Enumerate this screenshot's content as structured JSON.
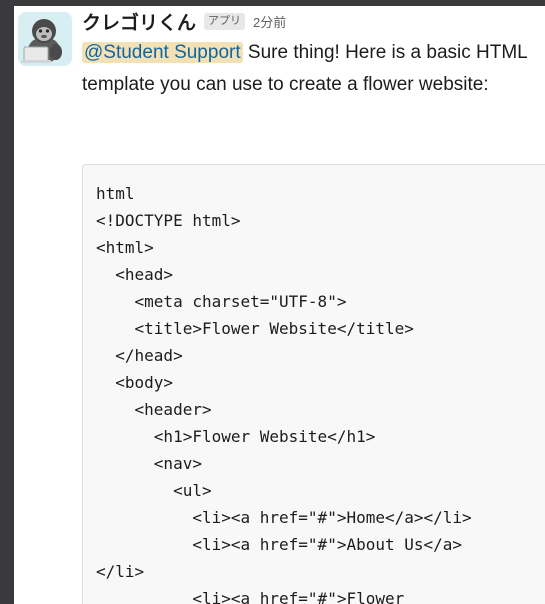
{
  "message": {
    "bot_name": "クレゴリくん",
    "app_badge": "アプリ",
    "timestamp": "2分前",
    "mention": "@Student Support",
    "text_after_mention": " Sure thing! Here is a basic HTML template you can use to create a flower website:",
    "code_lines": [
      "html",
      "<!DOCTYPE html>",
      "<html>",
      "  <head>",
      "    <meta charset=\"UTF-8\">",
      "    <title>Flower Website</title>",
      "  </head>",
      "  <body>",
      "    <header>",
      "      <h1>Flower Website</h1>",
      "      <nav>",
      "        <ul>",
      "          <li><a href=\"#\">Home</a></li>",
      "          <li><a href=\"#\">About Us</a>",
      "</li>",
      "          <li><a href=\"#\">Flower"
    ]
  },
  "colors": {
    "background": "#3a3a3c",
    "mention_bg": "#f2e1b4",
    "mention_text": "#1264a3",
    "code_bg": "#f8f8f8"
  },
  "icons": {
    "avatar": "gorilla-with-laptop-icon"
  }
}
